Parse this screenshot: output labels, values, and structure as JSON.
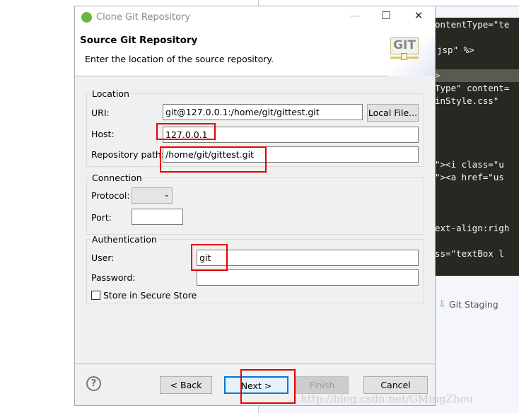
{
  "background": {
    "code_lines": [
      "ontentType=\"te",
      "jsp\" %>",
      ">",
      "Type\" content=",
      "inStyle.css\"",
      "\"><i class=\"u",
      "\"><a href=\"us",
      "ext-align:righ",
      "ss=\"textBox l"
    ],
    "git_staging_tab": "Git Staging"
  },
  "dialog": {
    "window_title": "Clone Git Repository",
    "header_title": "Source Git Repository",
    "header_description": "Enter the location of the source repository.",
    "logo_text": "GIT",
    "location": {
      "legend": "Location",
      "uri_label": "URI:",
      "uri_value": "git@127.0.0.1:/home/git/gittest.git",
      "local_file_button": "Local File...",
      "host_label": "Host:",
      "host_value": "127.0.0.1",
      "repo_path_label": "Repository path:",
      "repo_path_value": "/home/git/gittest.git"
    },
    "connection": {
      "legend": "Connection",
      "protocol_label": "Protocol:",
      "protocol_value": "",
      "port_label": "Port:",
      "port_value": ""
    },
    "authentication": {
      "legend": "Authentication",
      "user_label": "User:",
      "user_value": "git",
      "password_label": "Password:",
      "password_value": "",
      "store_label": "Store in Secure Store",
      "store_checked": false
    },
    "buttons": {
      "back": "< Back",
      "next": "Next >",
      "finish": "Finish",
      "cancel": "Cancel"
    }
  },
  "watermark": "http://blog.csdn.net/GMingZhou",
  "colors": {
    "annotation": "#e60000",
    "focus": "#0078d7",
    "code_bg": "#272822"
  }
}
